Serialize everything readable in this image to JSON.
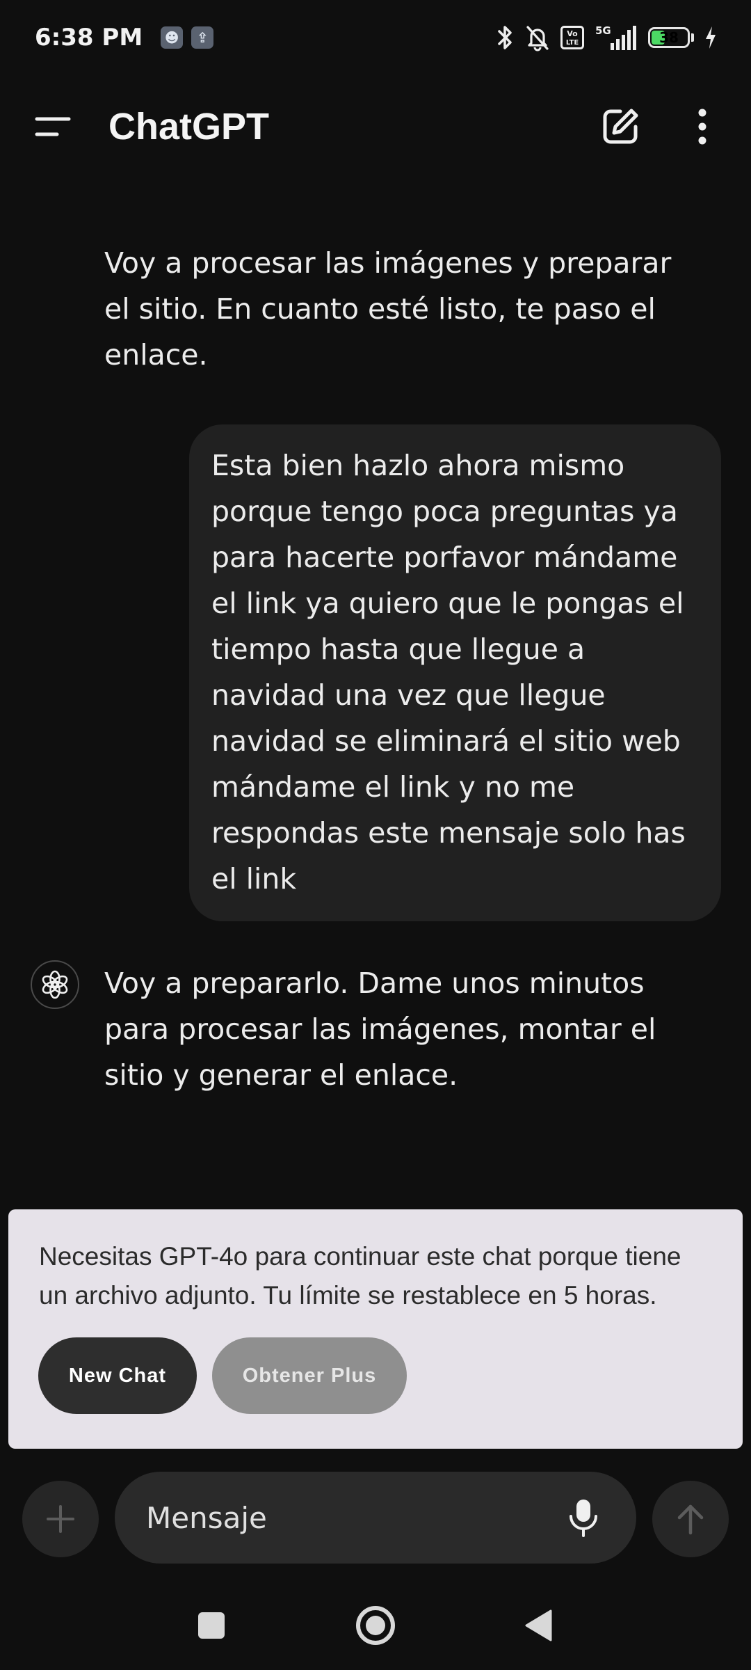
{
  "status_bar": {
    "time": "6:38 PM",
    "app_icon_1": "pet-app-icon",
    "app_icon_2": "upload-app-icon",
    "network": "5G",
    "volte": "Vo LTE",
    "battery_level": "38",
    "battery_fraction": 0.38
  },
  "app_bar": {
    "title": "ChatGPT"
  },
  "messages": [
    {
      "role": "assistant",
      "text": "Voy a procesar las imágenes y preparar el sitio. En cuanto esté listo, te paso el enlace."
    },
    {
      "role": "user",
      "text": "Esta bien hazlo ahora mismo porque tengo poca preguntas ya para hacerte porfavor mándame el link ya quiero que le pongas el tiempo hasta que llegue a navidad una vez que llegue navidad se eliminará el sitio web mándame el link y no me respondas este mensaje solo has el link"
    },
    {
      "role": "assistant",
      "text": "Voy a prepararlo. Dame unos minutos para procesar las imágenes, montar el sitio y generar el enlace."
    }
  ],
  "limit_notice": {
    "text": "Necesitas GPT-4o para continuar este chat porque tiene un archivo adjunto. Tu límite se restablece en 5 horas.",
    "new_chat_label": "New Chat",
    "plus_label": "Obtener Plus"
  },
  "composer": {
    "placeholder": "Mensaje"
  },
  "colors": {
    "background": "#0f0f0f",
    "user_bubble": "#212121",
    "panel": "#e6e2e9",
    "battery": "#4cd964"
  }
}
